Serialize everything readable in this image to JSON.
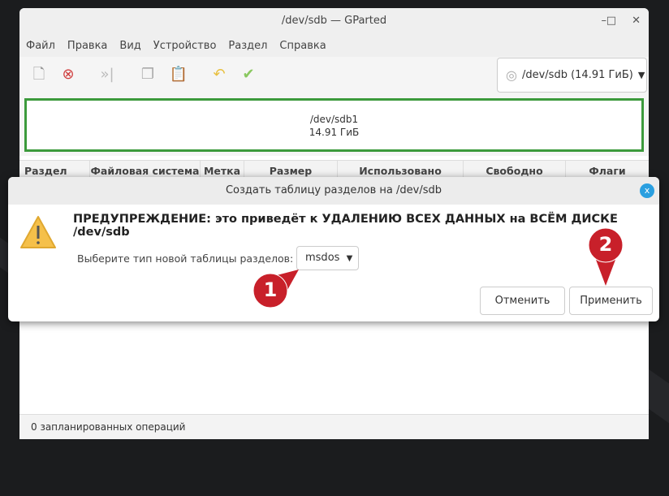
{
  "window": {
    "title": "/dev/sdb — GParted",
    "minimize": "–",
    "maximize": "□",
    "close": "✕"
  },
  "menu": [
    "Файл",
    "Правка",
    "Вид",
    "Устройство",
    "Раздел",
    "Справка"
  ],
  "device_selector": {
    "value": "/dev/sdb (14.91 ГиБ)"
  },
  "partition_graph": {
    "name": "/dev/sdb1",
    "size": "14.91 ГиБ"
  },
  "columns": [
    "Раздел",
    "Файловая система",
    "Метка",
    "Размер",
    "Использовано",
    "Свободно",
    "Флаги"
  ],
  "status": "0 запланированных операций",
  "dialog": {
    "title": "Создать таблицу разделов на /dev/sdb",
    "warning": "ПРЕДУПРЕЖДЕНИЕ: это приведёт к УДАЛЕНИЮ ВСЕХ ДАННЫХ на ВСЁМ ДИСКЕ /dev/sdb",
    "label": "Выберите тип новой таблицы разделов:",
    "table_type": "msdos",
    "cancel": "Отменить",
    "apply": "Применить",
    "close": "x"
  },
  "callouts": [
    "1",
    "2"
  ],
  "colors": {
    "accent_green": "#3c9a3c",
    "callout_red": "#c8202a",
    "close_blue": "#2a9fe0"
  }
}
